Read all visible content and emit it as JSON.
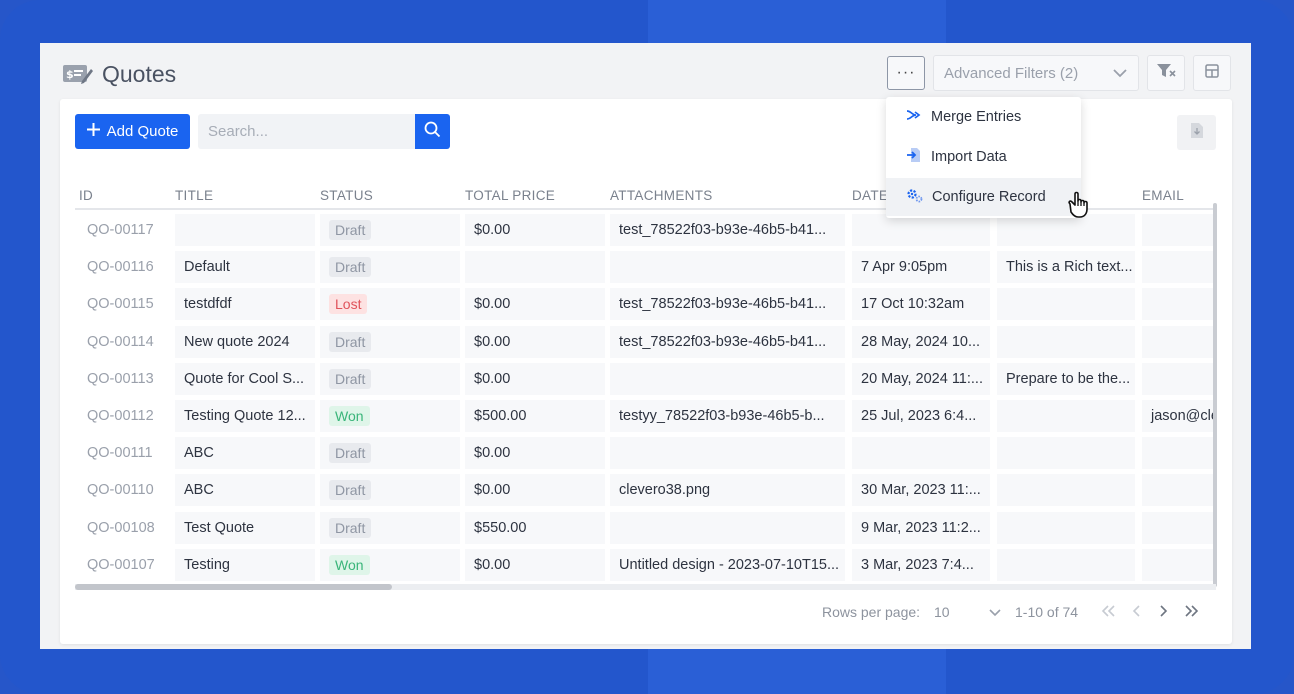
{
  "header": {
    "title": "Quotes",
    "more_label": "···",
    "advanced_filters_label": "Advanced Filters (2)"
  },
  "toolbar": {
    "add_label": "Add Quote",
    "search_placeholder": "Search..."
  },
  "menu": {
    "items": [
      {
        "label": "Merge Entries",
        "icon": "merge-icon"
      },
      {
        "label": "Import Data",
        "icon": "import-icon"
      },
      {
        "label": "Configure Record",
        "icon": "gears-icon"
      }
    ]
  },
  "table": {
    "columns": [
      "ID",
      "TITLE",
      "STATUS",
      "TOTAL PRICE",
      "ATTACHMENTS",
      "DATE",
      "",
      "EMAIL"
    ],
    "rows": [
      {
        "id": "QO-00117",
        "title": "",
        "status": "Draft",
        "price": "$0.00",
        "attachment": "test_78522f03-b93e-46b5-b41...",
        "date": "",
        "desc": "",
        "email": ""
      },
      {
        "id": "QO-00116",
        "title": "Default",
        "status": "Draft",
        "price": "",
        "attachment": "",
        "date": "7 Apr  9:05pm",
        "desc": "This is a Rich text...",
        "email": ""
      },
      {
        "id": "QO-00115",
        "title": "testdfdf",
        "status": "Lost",
        "price": "$0.00",
        "attachment": "test_78522f03-b93e-46b5-b41...",
        "date": "17 Oct  10:32am",
        "desc": "",
        "email": ""
      },
      {
        "id": "QO-00114",
        "title": "New quote 2024",
        "status": "Draft",
        "price": "$0.00",
        "attachment": "test_78522f03-b93e-46b5-b41...",
        "date": "28 May, 2024  10...",
        "desc": "",
        "email": ""
      },
      {
        "id": "QO-00113",
        "title": "Quote for Cool S...",
        "status": "Draft",
        "price": "$0.00",
        "attachment": "",
        "date": "20 May, 2024  11:...",
        "desc": "Prepare to be the...",
        "email": ""
      },
      {
        "id": "QO-00112",
        "title": "Testing Quote 12...",
        "status": "Won",
        "price": "$500.00",
        "attachment": "testyy_78522f03-b93e-46b5-b...",
        "date": "25 Jul, 2023  6:4...",
        "desc": "",
        "email": "jason@clev"
      },
      {
        "id": "QO-00111",
        "title": "ABC",
        "status": "Draft",
        "price": "$0.00",
        "attachment": "",
        "date": "",
        "desc": "",
        "email": ""
      },
      {
        "id": "QO-00110",
        "title": "ABC",
        "status": "Draft",
        "price": "$0.00",
        "attachment": "clevero38.png",
        "date": "30 Mar, 2023  11:...",
        "desc": "",
        "email": ""
      },
      {
        "id": "QO-00108",
        "title": "Test Quote",
        "status": "Draft",
        "price": "$550.00",
        "attachment": "",
        "date": "9 Mar, 2023  11:2...",
        "desc": "",
        "email": ""
      },
      {
        "id": "QO-00107",
        "title": "Testing",
        "status": "Won",
        "price": "$0.00",
        "attachment": "Untitled design - 2023-07-10T15...",
        "date": "3 Mar, 2023  7:4...",
        "desc": "",
        "email": ""
      }
    ]
  },
  "pagination": {
    "rows_per_page_label": "Rows per page:",
    "rows_per_page_value": "10",
    "range_text": "1-10 of 74"
  },
  "colors": {
    "primary": "#1a64f0",
    "background_frame": "#2356cc",
    "draft": "#8f96a3",
    "lost": "#e0535b",
    "won": "#3ab57a"
  }
}
